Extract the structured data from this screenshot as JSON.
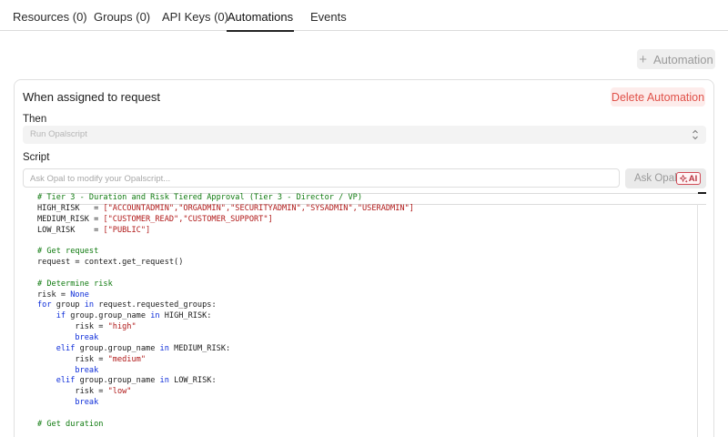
{
  "tabs": [
    {
      "label": "Resources (0)",
      "active": false
    },
    {
      "label": "Groups (0)",
      "active": false
    },
    {
      "label": "API Keys (0)",
      "active": false
    },
    {
      "label": "Automations",
      "active": true
    },
    {
      "label": "Events",
      "active": false
    }
  ],
  "toolbar": {
    "add_automation_label": "Automation",
    "add_icon": "plus-icon"
  },
  "automation": {
    "title": "When assigned to request",
    "delete_label": "Delete Automation",
    "then_label": "Then",
    "action_value": "Run Opalscript",
    "script_label": "Script",
    "ai_placeholder": "Ask Opal to modify your Opalscript...",
    "ask_label": "Ask Opal",
    "ai_badge": "AI"
  },
  "code_lines": [
    [
      [
        "# Tier 3 - Duration and Risk Tiered Approval (Tier 3 - Director / VP)",
        "c"
      ]
    ],
    [
      [
        "HIGH_RISK   = ",
        ""
      ],
      [
        "[\"ACCOUNTADMIN\",\"ORGADMIN\",\"SECURITYADMIN\",\"SYSADMIN\",\"USERADMIN\"]",
        "s"
      ]
    ],
    [
      [
        "MEDIUM_RISK = ",
        ""
      ],
      [
        "[\"CUSTOMER_READ\",\"CUSTOMER_SUPPORT\"]",
        "s"
      ]
    ],
    [
      [
        "LOW_RISK    = ",
        ""
      ],
      [
        "[\"PUBLIC\"]",
        "s"
      ]
    ],
    [
      [
        "",
        ""
      ]
    ],
    [
      [
        "# Get request",
        "c"
      ]
    ],
    [
      [
        "request = context.get_request()",
        ""
      ]
    ],
    [
      [
        "",
        ""
      ]
    ],
    [
      [
        "# Determine risk",
        "c"
      ]
    ],
    [
      [
        "risk = ",
        ""
      ],
      [
        "None",
        "n"
      ]
    ],
    [
      [
        "for",
        "k"
      ],
      [
        " group ",
        ""
      ],
      [
        "in",
        "k"
      ],
      [
        " request.requested_groups:",
        ""
      ]
    ],
    [
      [
        "    ",
        ""
      ],
      [
        "if",
        "k"
      ],
      [
        " group.group_name ",
        ""
      ],
      [
        "in",
        "k"
      ],
      [
        " HIGH_RISK:",
        ""
      ]
    ],
    [
      [
        "        risk = ",
        ""
      ],
      [
        "\"high\"",
        "s"
      ]
    ],
    [
      [
        "        ",
        ""
      ],
      [
        "break",
        "k"
      ]
    ],
    [
      [
        "    ",
        ""
      ],
      [
        "elif",
        "k"
      ],
      [
        " group.group_name ",
        ""
      ],
      [
        "in",
        "k"
      ],
      [
        " MEDIUM_RISK:",
        ""
      ]
    ],
    [
      [
        "        risk = ",
        ""
      ],
      [
        "\"medium\"",
        "s"
      ]
    ],
    [
      [
        "        ",
        ""
      ],
      [
        "break",
        "k"
      ]
    ],
    [
      [
        "    ",
        ""
      ],
      [
        "elif",
        "k"
      ],
      [
        " group.group_name ",
        ""
      ],
      [
        "in",
        "k"
      ],
      [
        " LOW_RISK:",
        ""
      ]
    ],
    [
      [
        "        risk = ",
        ""
      ],
      [
        "\"low\"",
        "s"
      ]
    ],
    [
      [
        "        ",
        ""
      ],
      [
        "break",
        "k"
      ]
    ],
    [
      [
        "",
        ""
      ]
    ],
    [
      [
        "# Get duration",
        "c"
      ]
    ]
  ]
}
